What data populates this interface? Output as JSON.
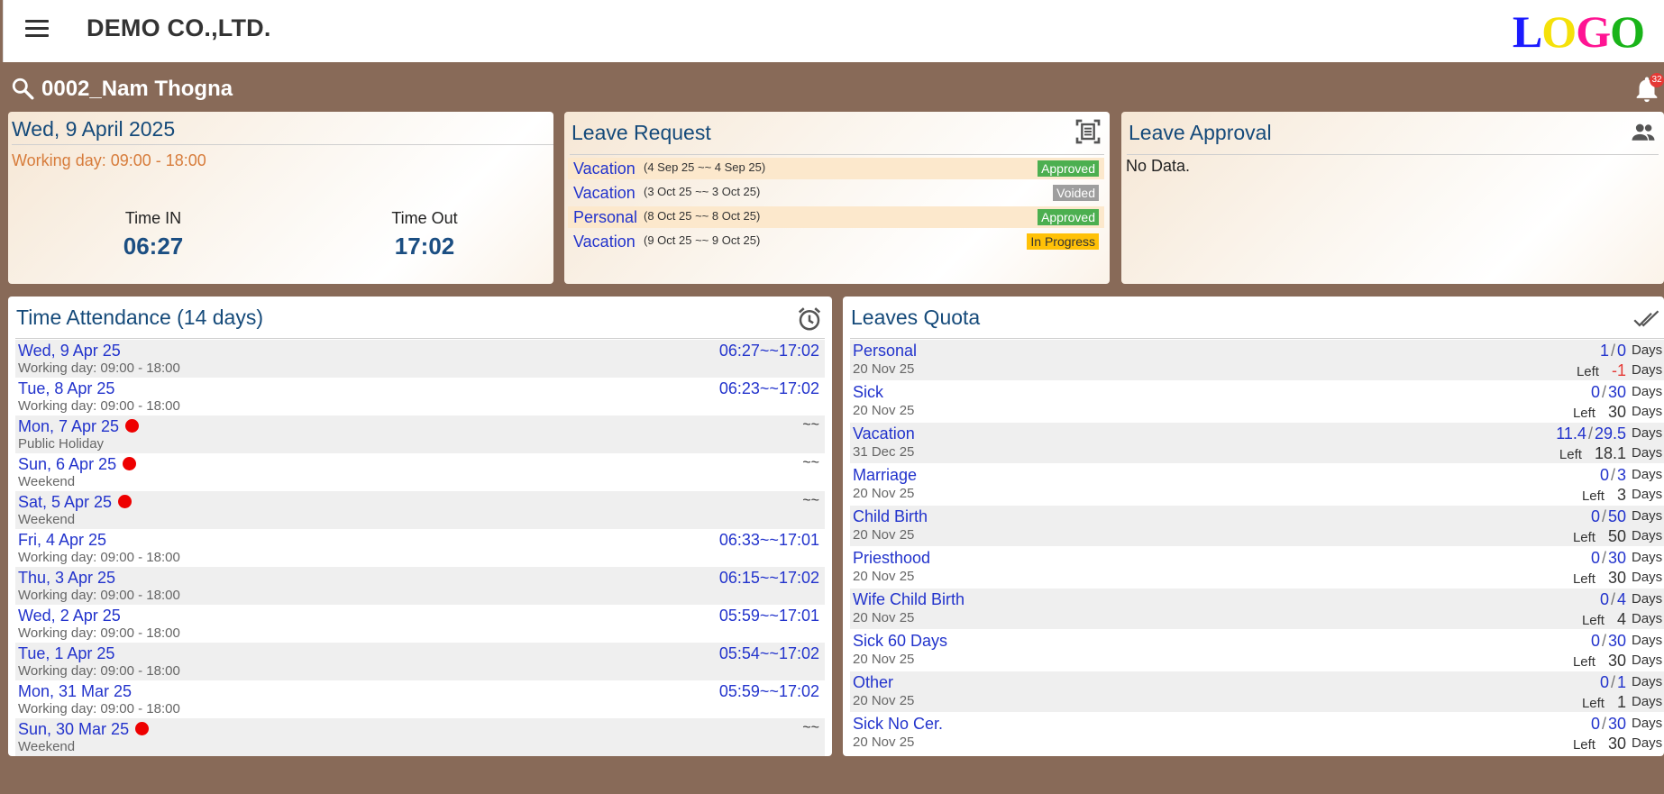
{
  "header": {
    "company": "DEMO CO.,LTD.",
    "logo_letters": [
      "L",
      "O",
      "G",
      "O"
    ],
    "logo_colors": [
      "#1a1aff",
      "#f5e10a",
      "#ff1493",
      "#19b419"
    ]
  },
  "user": {
    "name": "0002_Nam  Thogna",
    "notifications": "32"
  },
  "today": {
    "date": "Wed, 9 April 2025",
    "working_day": "Working day: 09:00 - 18:00",
    "time_in_label": "Time IN",
    "time_in": "06:27",
    "time_out_label": "Time Out",
    "time_out": "17:02"
  },
  "leave_request": {
    "title": "Leave Request",
    "items": [
      {
        "type": "Vacation",
        "range": "(4 Sep 25 ~~ 4 Sep 25)",
        "status": "Approved"
      },
      {
        "type": "Vacation",
        "range": "(3 Oct 25 ~~ 3 Oct 25)",
        "status": "Voided"
      },
      {
        "type": "Personal",
        "range": "(8 Oct 25 ~~ 8 Oct 25)",
        "status": "Approved"
      },
      {
        "type": "Vacation",
        "range": "(9 Oct 25 ~~ 9 Oct 25)",
        "status": "In Progress"
      }
    ]
  },
  "leave_approval": {
    "title": "Leave Approval",
    "empty": "No Data."
  },
  "attendance": {
    "title": "Time Attendance (14 days)",
    "rows": [
      {
        "date": "Wed, 9 Apr 25",
        "sub": "Working day: 09:00 - 18:00",
        "time": "06:27~~17:02",
        "holiday": false
      },
      {
        "date": "Tue, 8 Apr 25",
        "sub": "Working day: 09:00 - 18:00",
        "time": "06:23~~17:02",
        "holiday": false
      },
      {
        "date": "Mon, 7 Apr 25",
        "sub": "Public Holiday",
        "time": "~~",
        "holiday": true
      },
      {
        "date": "Sun, 6 Apr 25",
        "sub": "Weekend",
        "time": "~~",
        "holiday": true
      },
      {
        "date": "Sat, 5 Apr 25",
        "sub": "Weekend",
        "time": "~~",
        "holiday": true
      },
      {
        "date": "Fri, 4 Apr 25",
        "sub": "Working day: 09:00 - 18:00",
        "time": "06:33~~17:01",
        "holiday": false
      },
      {
        "date": "Thu, 3 Apr 25",
        "sub": "Working day: 09:00 - 18:00",
        "time": "06:15~~17:02",
        "holiday": false
      },
      {
        "date": "Wed, 2 Apr 25",
        "sub": "Working day: 09:00 - 18:00",
        "time": "05:59~~17:01",
        "holiday": false
      },
      {
        "date": "Tue, 1 Apr 25",
        "sub": "Working day: 09:00 - 18:00",
        "time": "05:54~~17:02",
        "holiday": false
      },
      {
        "date": "Mon, 31 Mar 25",
        "sub": "Working day: 09:00 - 18:00",
        "time": "05:59~~17:02",
        "holiday": false
      },
      {
        "date": "Sun, 30 Mar 25",
        "sub": "Weekend",
        "time": "~~",
        "holiday": true
      }
    ]
  },
  "quota": {
    "title": "Leaves Quota",
    "days_label": "Days",
    "left_label": "Left",
    "rows": [
      {
        "name": "Personal",
        "date": "20 Nov 25",
        "used": "1",
        "total": "0",
        "left": "-1"
      },
      {
        "name": "Sick",
        "date": "20 Nov 25",
        "used": "0",
        "total": "30",
        "left": "30"
      },
      {
        "name": "Vacation",
        "date": "31 Dec 25",
        "used": "11.4",
        "total": "29.5",
        "left": "18.1"
      },
      {
        "name": "Marriage",
        "date": "20 Nov 25",
        "used": "0",
        "total": "3",
        "left": "3"
      },
      {
        "name": "Child Birth",
        "date": "20 Nov 25",
        "used": "0",
        "total": "50",
        "left": "50"
      },
      {
        "name": "Priesthood",
        "date": "20 Nov 25",
        "used": "0",
        "total": "30",
        "left": "30"
      },
      {
        "name": "Wife Child Birth",
        "date": "20 Nov 25",
        "used": "0",
        "total": "4",
        "left": "4"
      },
      {
        "name": "Sick 60 Days",
        "date": "20 Nov 25",
        "used": "0",
        "total": "30",
        "left": "30"
      },
      {
        "name": "Other",
        "date": "20 Nov 25",
        "used": "0",
        "total": "1",
        "left": "1"
      },
      {
        "name": "Sick No Cer.",
        "date": "20 Nov 25",
        "used": "0",
        "total": "30",
        "left": "30"
      }
    ]
  },
  "colors": {
    "background": "#886a58",
    "title": "#154a7a",
    "link": "#2233cc",
    "approved": "#4caf50",
    "voided": "#9e9e9e",
    "in_progress": "#ffc107"
  }
}
